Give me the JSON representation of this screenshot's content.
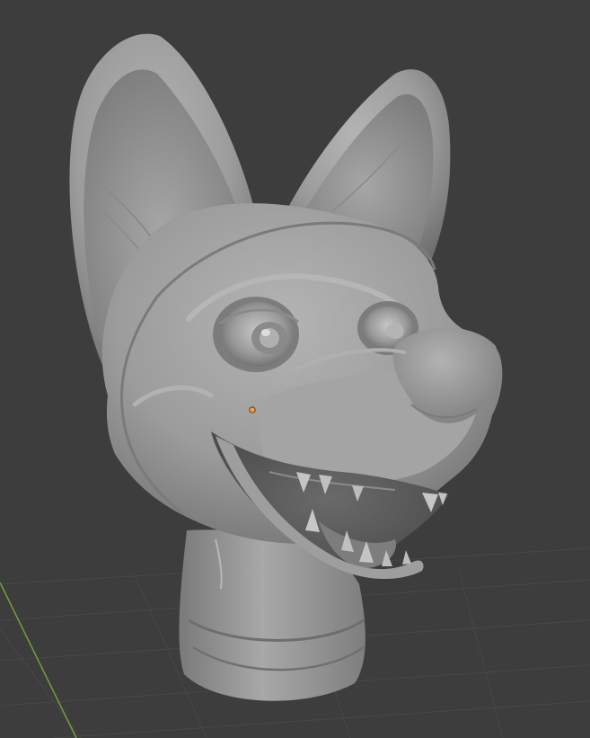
{
  "viewport": {
    "background_color": "#3d3d3d",
    "grid_line_color": "#474747",
    "x_axis_color": "#6f9a3a",
    "model_base_color": "#9a9a9a",
    "origin_marker_color": "#f5a33a"
  },
  "scene": {
    "subject_icon": "fox-head-sculpt-icon",
    "origin_icon": "object-origin-icon"
  }
}
